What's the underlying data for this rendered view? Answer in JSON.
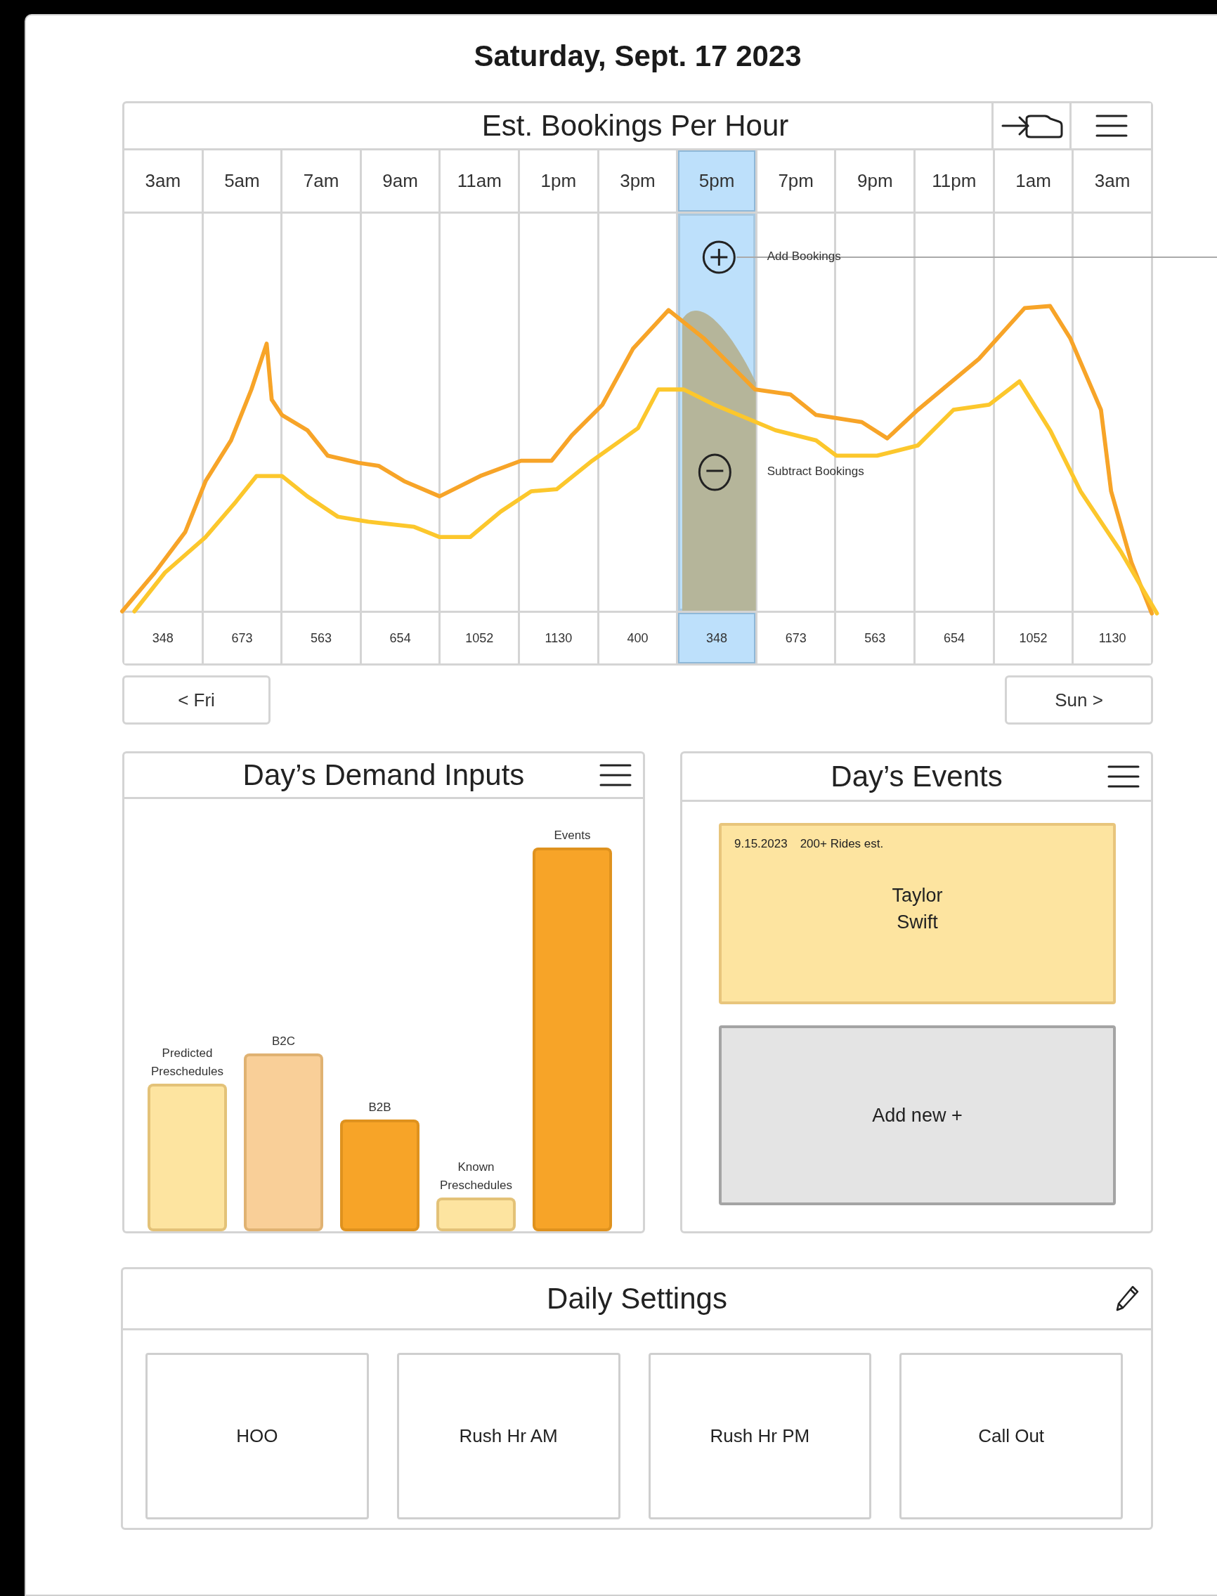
{
  "page_title": "Saturday, Sept. 17 2023",
  "bookings_chart": {
    "title": "Est. Bookings Per Hour",
    "columns": [
      {
        "hour": "3am",
        "value": "348",
        "selected": false
      },
      {
        "hour": "5am",
        "value": "673",
        "selected": false
      },
      {
        "hour": "7am",
        "value": "563",
        "selected": false
      },
      {
        "hour": "9am",
        "value": "654",
        "selected": false
      },
      {
        "hour": "11am",
        "value": "1052",
        "selected": false
      },
      {
        "hour": "1pm",
        "value": "1130",
        "selected": false
      },
      {
        "hour": "3pm",
        "value": "400",
        "selected": false
      },
      {
        "hour": "5pm",
        "value": "348",
        "selected": true
      },
      {
        "hour": "7pm",
        "value": "673",
        "selected": false
      },
      {
        "hour": "9pm",
        "value": "563",
        "selected": false
      },
      {
        "hour": "11pm",
        "value": "654",
        "selected": false
      },
      {
        "hour": "1am",
        "value": "1052",
        "selected": false
      },
      {
        "hour": "3am",
        "value": "1130",
        "selected": false
      }
    ],
    "annotations": [
      {
        "kind": "add",
        "label": "Add Bookings"
      },
      {
        "kind": "subtract",
        "label": "Subtract Bookings"
      }
    ]
  },
  "day_nav": {
    "previous": "< Fri",
    "next": "Sun >"
  },
  "demand_inputs": {
    "title": "Day’s Demand Inputs",
    "bars": [
      {
        "label": "Predicted Preschedules",
        "color": "#fde4a0"
      },
      {
        "label": "B2C",
        "color": "#f9cf98"
      },
      {
        "label": "B2B",
        "color": "#f7a428"
      },
      {
        "label": "Known Preschedules",
        "color": "#fde4a0"
      },
      {
        "label": "Events",
        "color": "#f7a428"
      }
    ]
  },
  "events": {
    "title": "Day’s Events",
    "cards": [
      {
        "date": "9.15.2023",
        "estimate": "200+ Rides est.",
        "name": "Taylor Swift"
      }
    ],
    "add_button": "Add new +"
  },
  "daily_settings": {
    "title": "Daily Settings",
    "items": [
      "HOO",
      "Rush Hr AM",
      "Rush Hr PM",
      "Call Out"
    ]
  }
}
